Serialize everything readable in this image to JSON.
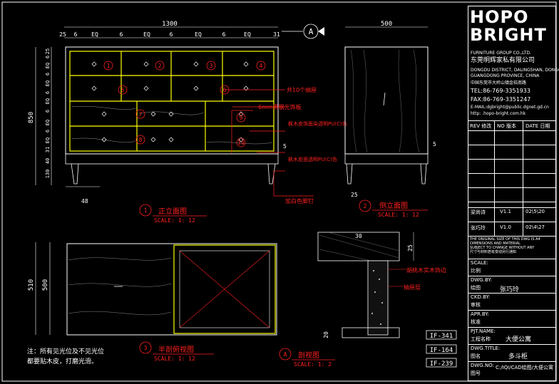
{
  "front": {
    "overall_width": "1300",
    "top_dims": [
      "25",
      "6",
      "EQ",
      "6",
      "EQ",
      "6",
      "EQ",
      "6",
      "EQ",
      "31"
    ],
    "left_dims": [
      "25",
      "6",
      "EQ",
      "6",
      "EQ",
      "6",
      "EQ",
      "6",
      "EQ",
      "31",
      "6",
      "EQ",
      "6",
      "EQ",
      "6",
      "EQ",
      "6",
      "EQ",
      "6"
    ],
    "height": "850",
    "height_bottom": [
      "130",
      "40"
    ],
    "leg": "48",
    "section_mark": "A",
    "drawer_numbers": [
      "1",
      "2",
      "3",
      "4",
      "5",
      "6",
      "7",
      "8",
      "9",
      "10"
    ],
    "notes": [
      "共10个抽屉",
      "6mm黑钢光饰板",
      "枫木皮饰面染透明PU(C)色",
      "枫木皮面透明PU(C)色",
      "加白色脚钉"
    ],
    "right_dim": "5",
    "title_num": "1",
    "title": "正立面图",
    "scale": "SCALE: 1: 12"
  },
  "side": {
    "width": "500",
    "leg": "25",
    "right_dim": "5",
    "title_num": "2",
    "title": "侧立面图",
    "scale": "SCALE: 1: 12"
  },
  "plan": {
    "dims": [
      "510",
      "500"
    ],
    "title_num": "3",
    "title": "半剖俯视图",
    "scale": "SCALE: 1: 12",
    "note_line1": "注：所有见光位及不见光位",
    "note_line2": "都要贴木皮，打磨光滑。"
  },
  "section": {
    "dims": [
      "25",
      "30",
      "20"
    ],
    "notes": [
      "胡桃木实木饰边",
      "抽屉层"
    ],
    "title_num": "A",
    "title": "剖视图",
    "scale": "SCALE: 1: 2",
    "codes": [
      "IF-341",
      "IF-164",
      "IF-239"
    ]
  },
  "titleblock": {
    "logo_top": "HOPO",
    "logo_bottom": "BRIGHT",
    "company_en": "FURNITURE GROUP CO.,LTD.",
    "company_cn": "东莞明辉家私有限公司",
    "addr1": "DONGDU DISTRICT, DALINGSHAN, DONGGUAN",
    "addr2": "GUANGDONG PROVINCE, CHINA",
    "addr_cn": "中国东莞市大岭山镇金桔南路",
    "tel": "TEL:86-769-3351933",
    "fax": "FAX:86-769-3351247",
    "email": "E-MAIL:dgbright@public.dgnet.gd.cn",
    "web": "http: .hopo-bright.com.hk",
    "rev_headers": [
      "REV 修改",
      "NO 版本",
      "DATE 日期"
    ],
    "revisions": [
      {
        "by": "梁尚诗",
        "ver": "V1.1",
        "date": "02\\5\\20"
      },
      {
        "by": "张巧玲",
        "ver": "V1.0",
        "date": "02\\4\\27"
      }
    ],
    "disclaimer1": "THE ORIGINAL SIZE OF THIS DWG IS A4",
    "disclaimer2": "DIMENSIONS AND MATERIAL",
    "disclaimer3": "SUBJECT TO CHANGE WITHOUT ANY",
    "disclaimer4": "尺寸与材料若有变动另行通知",
    "scale_label": "SCALE:",
    "scale_cn": "比例",
    "dwg_by_label": "DWG.BY:",
    "dwg_by_cn": "绘图",
    "dwg_by": "张巧玲",
    "ckd_label": "CKD.BY:",
    "ckd_cn": "审核",
    "apr_label": "APR.BY:",
    "apr_cn": "核准",
    "pjt_label": "PJT.NAME:",
    "pjt_cn": "工程名称",
    "pjt": "大便公寓",
    "dwg_title_label": "DWG.TITLE:",
    "dwg_title_cn": "图名",
    "dwg_title": "多斗柜",
    "dwg_no_label": "DWG.NO:",
    "dwg_no_cn": "图号",
    "dwg_no": "C:/IQI/CAD绘图/大便公寓"
  }
}
